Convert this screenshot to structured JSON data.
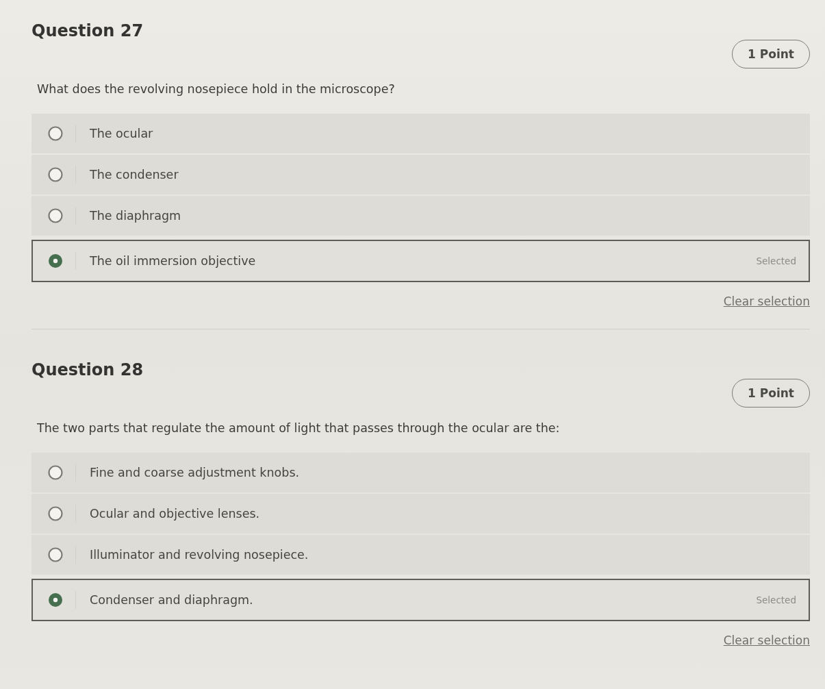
{
  "questions": [
    {
      "title": "Question 27",
      "points": "1 Point",
      "prompt": "What does the revolving nosepiece hold in the microscope?",
      "options": [
        {
          "label": "The ocular",
          "selected": false
        },
        {
          "label": "The condenser",
          "selected": false
        },
        {
          "label": "The diaphragm",
          "selected": false
        },
        {
          "label": "The oil immersion objective",
          "selected": true,
          "status": "Selected"
        }
      ],
      "clear_link": "Clear selection"
    },
    {
      "title": "Question 28",
      "points": "1 Point",
      "prompt": "The two parts that regulate the amount of light that passes through the ocular are the:",
      "options": [
        {
          "label": "Fine and coarse adjustment knobs.",
          "selected": false
        },
        {
          "label": "Ocular and objective lenses.",
          "selected": false
        },
        {
          "label": "Illuminator and revolving nosepiece.",
          "selected": false
        },
        {
          "label": "Condenser and diaphragm.",
          "selected": true,
          "status": "Selected"
        }
      ],
      "clear_link": "Clear selection"
    }
  ]
}
